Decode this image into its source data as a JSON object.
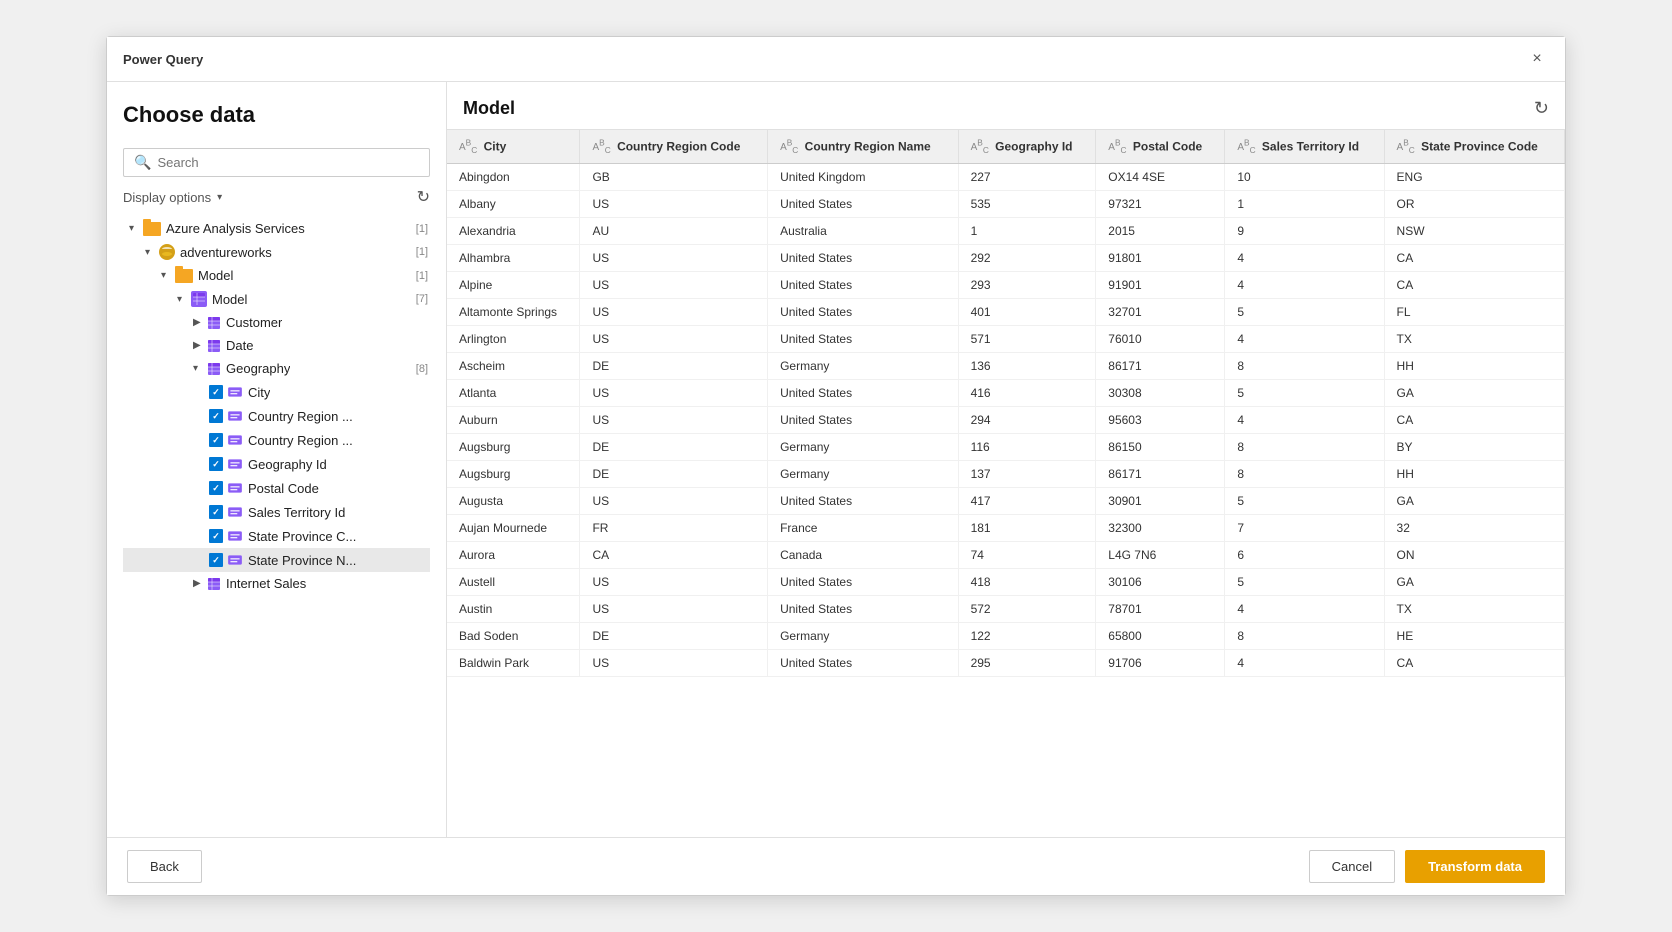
{
  "titleBar": {
    "title": "Power Query",
    "closeLabel": "×"
  },
  "leftPanel": {
    "heading": "Choose data",
    "searchPlaceholder": "Search",
    "displayOptions": "Display options",
    "refreshLabel": "↻",
    "tree": [
      {
        "id": "azure",
        "level": 1,
        "expanded": true,
        "type": "folder",
        "label": "Azure Analysis Services",
        "count": "[1]",
        "arrow": "▾"
      },
      {
        "id": "adventureworks",
        "level": 2,
        "expanded": true,
        "type": "db",
        "label": "adventureworks",
        "count": "[1]",
        "arrow": "▾"
      },
      {
        "id": "model-root",
        "level": 3,
        "expanded": true,
        "type": "folder",
        "label": "Model",
        "count": "[1]",
        "arrow": "▾"
      },
      {
        "id": "model",
        "level": 4,
        "expanded": true,
        "type": "table",
        "label": "Model",
        "count": "[7]",
        "arrow": "▾"
      },
      {
        "id": "customer",
        "level": 5,
        "expanded": false,
        "type": "column",
        "label": "Customer",
        "count": "",
        "arrow": "▶"
      },
      {
        "id": "date",
        "level": 5,
        "expanded": false,
        "type": "column",
        "label": "Date",
        "count": "",
        "arrow": "▶"
      },
      {
        "id": "geography",
        "level": 5,
        "expanded": true,
        "type": "column-table",
        "label": "Geography",
        "count": "[8]",
        "arrow": "▾"
      },
      {
        "id": "city",
        "level": 6,
        "expanded": false,
        "type": "field-checked",
        "label": "City",
        "count": ""
      },
      {
        "id": "country-region-1",
        "level": 6,
        "expanded": false,
        "type": "field-checked",
        "label": "Country Region ...",
        "count": ""
      },
      {
        "id": "country-region-2",
        "level": 6,
        "expanded": false,
        "type": "field-checked",
        "label": "Country Region ...",
        "count": ""
      },
      {
        "id": "geography-id",
        "level": 6,
        "expanded": false,
        "type": "field-checked",
        "label": "Geography Id",
        "count": ""
      },
      {
        "id": "postal-code",
        "level": 6,
        "expanded": false,
        "type": "field-checked",
        "label": "Postal Code",
        "count": ""
      },
      {
        "id": "sales-territory-id",
        "level": 6,
        "expanded": false,
        "type": "field-checked",
        "label": "Sales Territory Id",
        "count": ""
      },
      {
        "id": "state-province-c",
        "level": 6,
        "expanded": false,
        "type": "field-checked",
        "label": "State Province C...",
        "count": ""
      },
      {
        "id": "state-province-n",
        "level": 6,
        "expanded": false,
        "type": "field-checked-selected",
        "label": "State Province N...",
        "count": ""
      },
      {
        "id": "internet-sales",
        "level": 5,
        "expanded": false,
        "type": "column",
        "label": "Internet Sales",
        "count": "",
        "arrow": "▶"
      }
    ]
  },
  "rightPanel": {
    "title": "Model",
    "columns": [
      {
        "id": "city",
        "type": "ABC",
        "label": "City"
      },
      {
        "id": "country-region-code",
        "type": "ABC",
        "label": "Country Region Code"
      },
      {
        "id": "country-region-name",
        "type": "ABC",
        "label": "Country Region Name"
      },
      {
        "id": "geography-id",
        "type": "ABC",
        "label": "Geography Id"
      },
      {
        "id": "postal-code",
        "type": "ABC",
        "label": "Postal Code"
      },
      {
        "id": "sales-territory-id",
        "type": "ABC",
        "label": "Sales Territory Id"
      },
      {
        "id": "state-province-code",
        "type": "ABC",
        "label": "State Province Code"
      }
    ],
    "rows": [
      [
        "Abingdon",
        "GB",
        "United Kingdom",
        "227",
        "OX14 4SE",
        "10",
        "ENG"
      ],
      [
        "Albany",
        "US",
        "United States",
        "535",
        "97321",
        "1",
        "OR"
      ],
      [
        "Alexandria",
        "AU",
        "Australia",
        "1",
        "2015",
        "9",
        "NSW"
      ],
      [
        "Alhambra",
        "US",
        "United States",
        "292",
        "91801",
        "4",
        "CA"
      ],
      [
        "Alpine",
        "US",
        "United States",
        "293",
        "91901",
        "4",
        "CA"
      ],
      [
        "Altamonte Springs",
        "US",
        "United States",
        "401",
        "32701",
        "5",
        "FL"
      ],
      [
        "Arlington",
        "US",
        "United States",
        "571",
        "76010",
        "4",
        "TX"
      ],
      [
        "Ascheim",
        "DE",
        "Germany",
        "136",
        "86171",
        "8",
        "HH"
      ],
      [
        "Atlanta",
        "US",
        "United States",
        "416",
        "30308",
        "5",
        "GA"
      ],
      [
        "Auburn",
        "US",
        "United States",
        "294",
        "95603",
        "4",
        "CA"
      ],
      [
        "Augsburg",
        "DE",
        "Germany",
        "116",
        "86150",
        "8",
        "BY"
      ],
      [
        "Augsburg",
        "DE",
        "Germany",
        "137",
        "86171",
        "8",
        "HH"
      ],
      [
        "Augusta",
        "US",
        "United States",
        "417",
        "30901",
        "5",
        "GA"
      ],
      [
        "Aujan Mournede",
        "FR",
        "France",
        "181",
        "32300",
        "7",
        "32"
      ],
      [
        "Aurora",
        "CA",
        "Canada",
        "74",
        "L4G 7N6",
        "6",
        "ON"
      ],
      [
        "Austell",
        "US",
        "United States",
        "418",
        "30106",
        "5",
        "GA"
      ],
      [
        "Austin",
        "US",
        "United States",
        "572",
        "78701",
        "4",
        "TX"
      ],
      [
        "Bad Soden",
        "DE",
        "Germany",
        "122",
        "65800",
        "8",
        "HE"
      ],
      [
        "Baldwin Park",
        "US",
        "United States",
        "295",
        "91706",
        "4",
        "CA"
      ]
    ]
  },
  "footer": {
    "backLabel": "Back",
    "cancelLabel": "Cancel",
    "transformLabel": "Transform data"
  }
}
